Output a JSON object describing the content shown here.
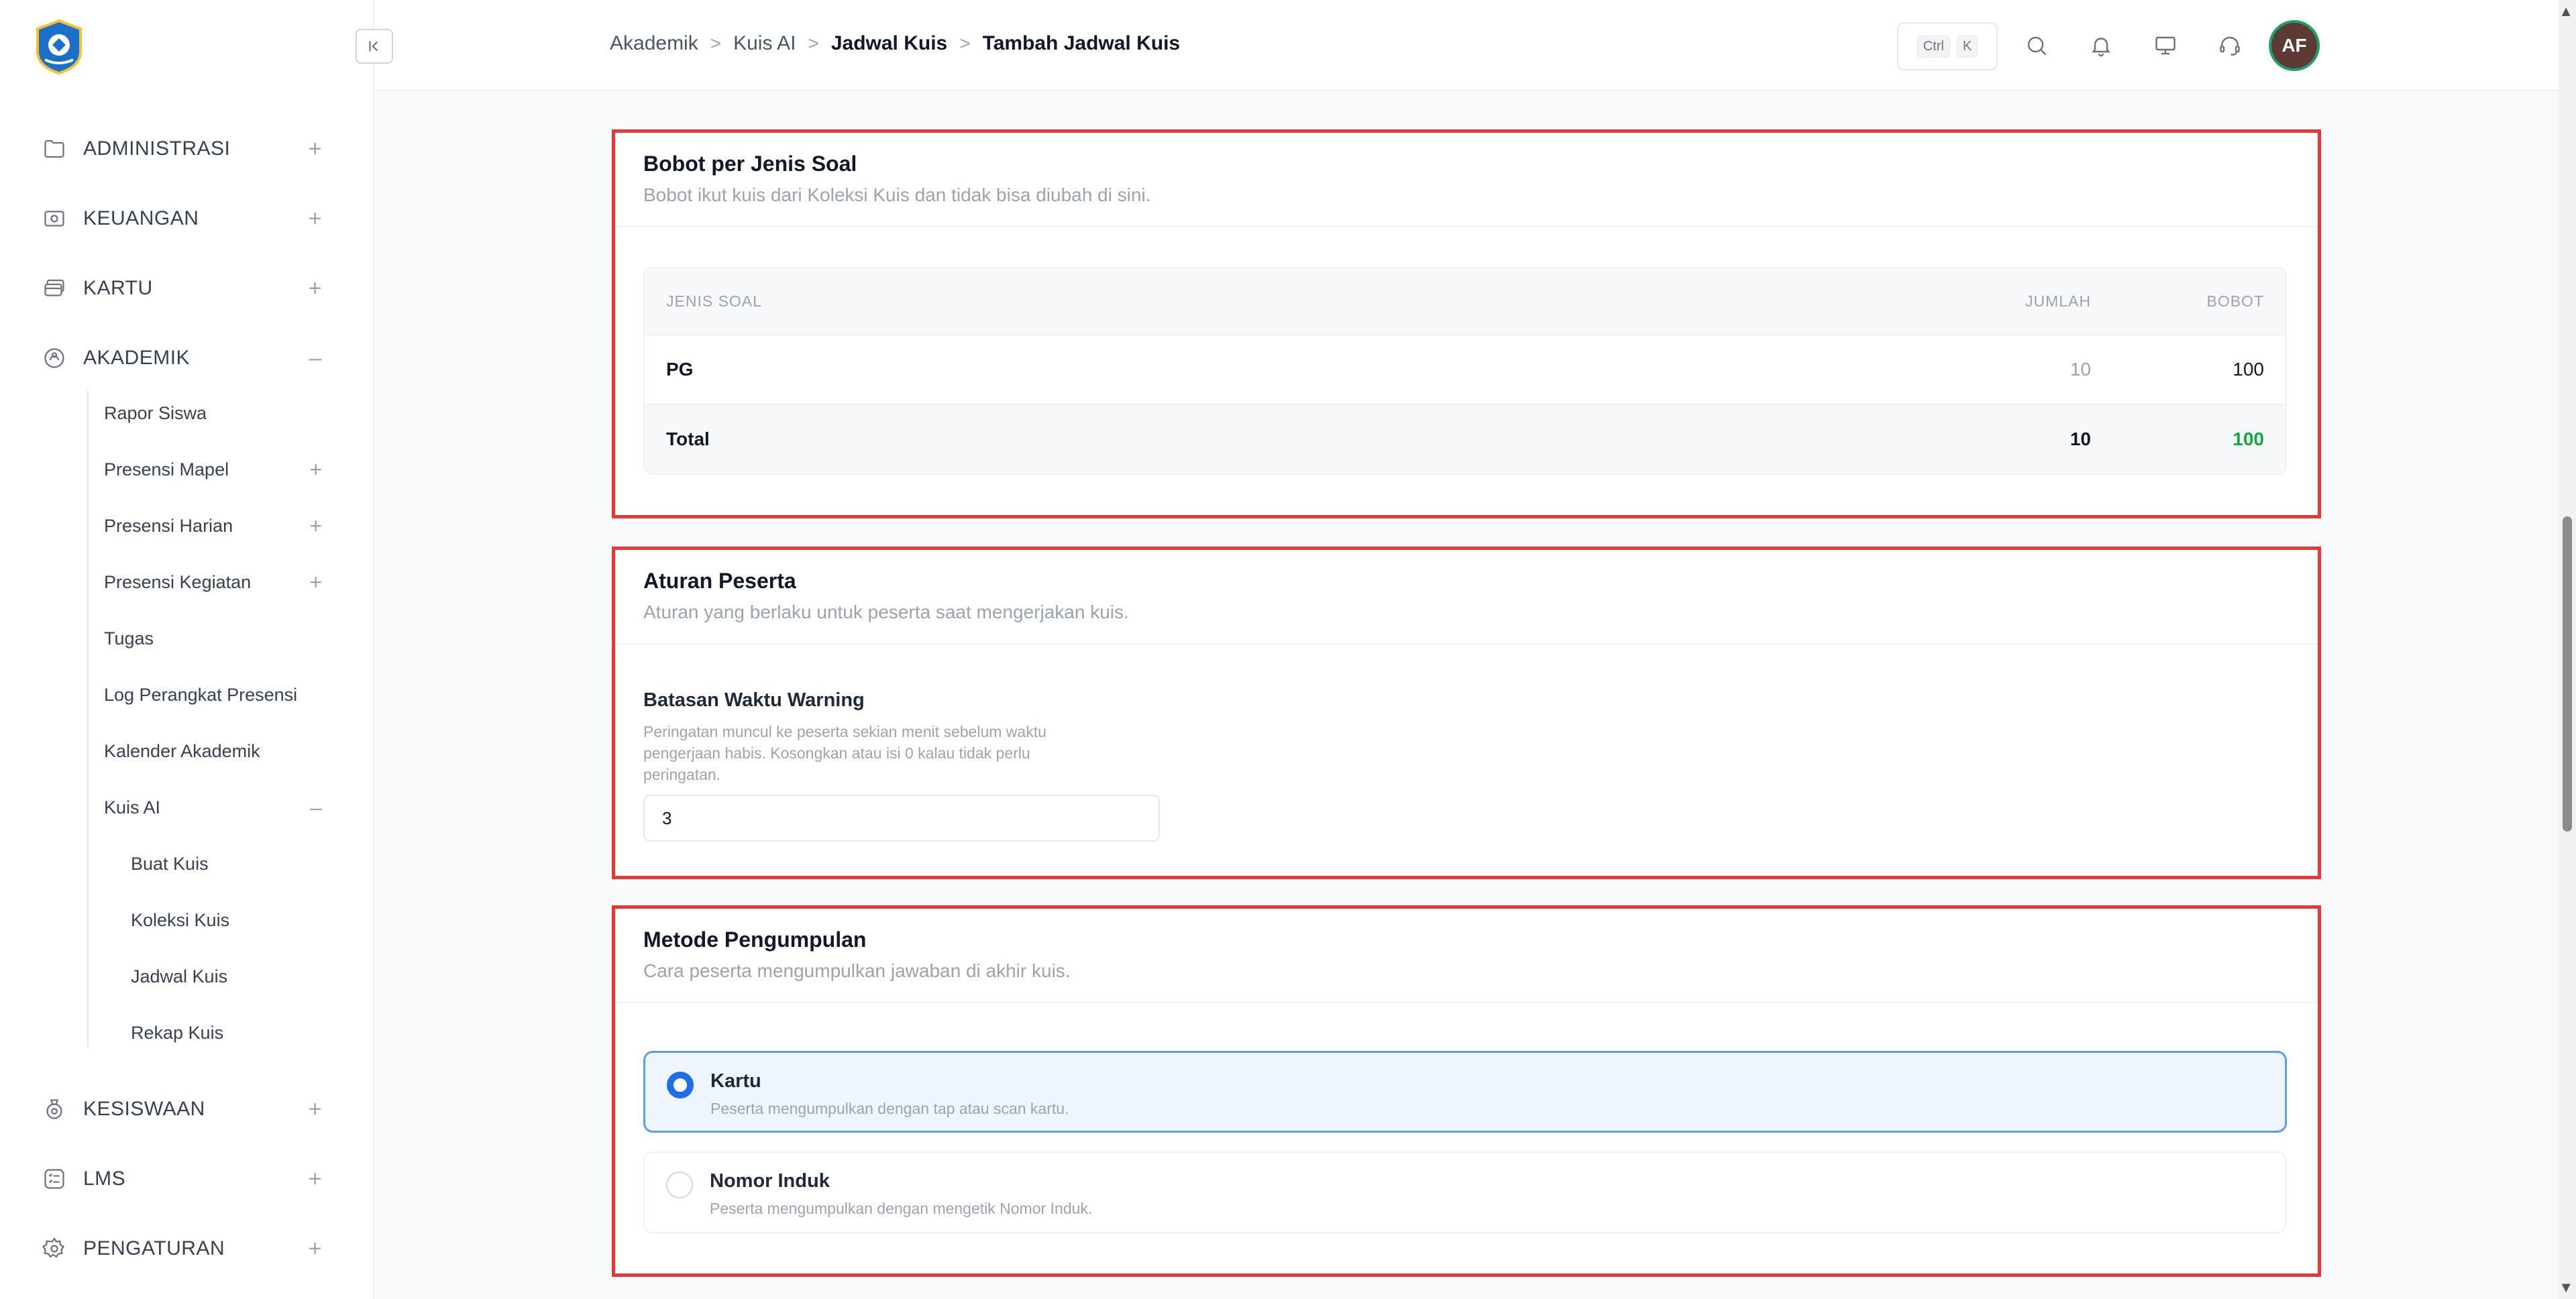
{
  "sidebar": {
    "items": [
      {
        "label": "ADMINISTRASI",
        "icon": "folder-icon"
      },
      {
        "label": "KEUANGAN",
        "icon": "money-icon"
      },
      {
        "label": "KARTU",
        "icon": "card-icon"
      },
      {
        "label": "AKADEMIK",
        "icon": "academic-icon"
      },
      {
        "label": "KESISWAAN",
        "icon": "student-icon"
      },
      {
        "label": "LMS",
        "icon": "lms-icon"
      },
      {
        "label": "PENGATURAN",
        "icon": "gear-icon"
      }
    ],
    "akademik_sub": [
      "Rapor Siswa",
      "Presensi Mapel",
      "Presensi Harian",
      "Presensi Kegiatan",
      "Tugas",
      "Log Perangkat Presensi",
      "Kalender Akademik",
      "Kuis AI"
    ],
    "kuis_sub": [
      "Buat Kuis",
      "Koleksi Kuis",
      "Jadwal Kuis",
      "Rekap Kuis"
    ],
    "plus": "+",
    "minus": "–"
  },
  "header": {
    "breadcrumb": [
      "Akademik",
      "Kuis AI",
      "Jadwal Kuis",
      "Tambah Jadwal Kuis"
    ],
    "sep": ">",
    "shortcut_ctrl": "Ctrl",
    "shortcut_k": "K",
    "avatar": "AF"
  },
  "bobot": {
    "title": "Bobot per Jenis Soal",
    "subtitle": "Bobot ikut kuis dari Koleksi Kuis dan tidak bisa diubah di sini.",
    "columns": [
      "JENIS SOAL",
      "JUMLAH",
      "BOBOT"
    ],
    "rows": [
      {
        "jenis": "PG",
        "jumlah": "10",
        "bobot": "100"
      }
    ],
    "total": {
      "label": "Total",
      "jumlah": "10",
      "bobot": "100"
    }
  },
  "aturan": {
    "title": "Aturan Peserta",
    "subtitle": "Aturan yang berlaku untuk peserta saat mengerjakan kuis.",
    "field_label": "Batasan Waktu Warning",
    "field_help_1": "Peringatan muncul ke peserta sekian menit sebelum waktu",
    "field_help_2": "pengerjaan habis. Kosongkan atau isi 0 kalau tidak perlu",
    "field_help_3": "peringatan.",
    "field_value": "3"
  },
  "metode": {
    "title": "Metode Pengumpulan",
    "subtitle": "Cara peserta mengumpulkan jawaban di akhir kuis.",
    "options": [
      {
        "label": "Kartu",
        "desc": "Peserta mengumpulkan dengan tap atau scan kartu.",
        "selected": true
      },
      {
        "label": "Nomor Induk",
        "desc": "Peserta mengumpulkan dengan mengetik Nomor Induk.",
        "selected": false
      }
    ]
  },
  "colors": {
    "accent": "#1d6fe8",
    "highlight": "#e53935",
    "success": "#16a34a"
  }
}
